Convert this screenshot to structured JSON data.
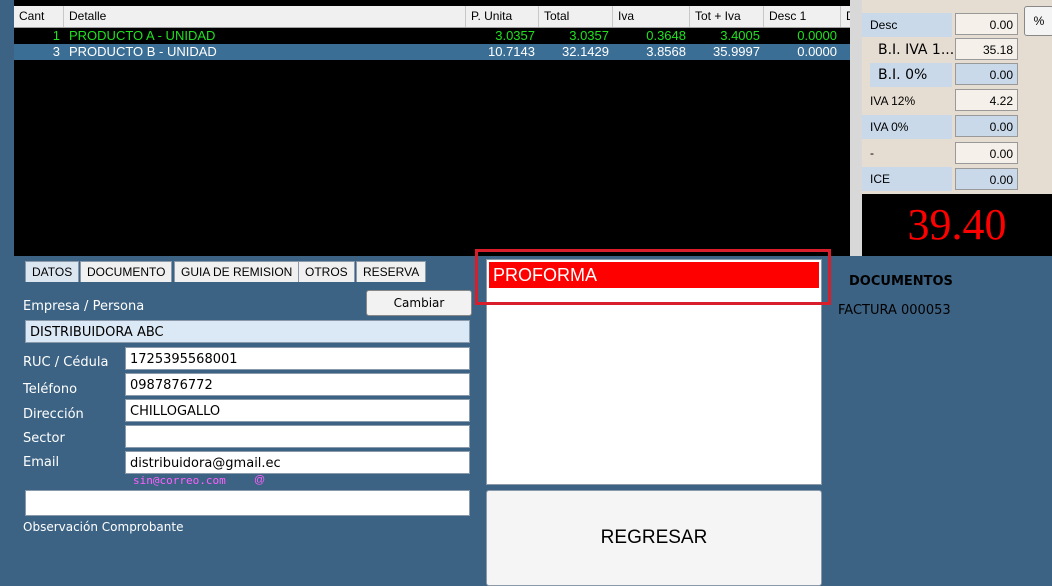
{
  "table": {
    "headers": [
      "Cant",
      "Detalle",
      "P. Unita",
      "Total",
      "Iva",
      "Tot + Iva",
      "Desc 1",
      "D"
    ],
    "rows": [
      [
        "1",
        "PRODUCTO A  - UNIDAD",
        "3.0357",
        "3.0357",
        "0.3648",
        "3.4005",
        "0.0000"
      ],
      [
        "3",
        "PRODUCTO B  - UNIDAD",
        "10.7143",
        "32.1429",
        "3.8568",
        "35.9997",
        "0.0000"
      ]
    ]
  },
  "totals": {
    "desc_label": "Desc",
    "desc_value": "0.00",
    "bi_iva_label": "B.I. IVA 1...",
    "bi_iva_value": "35.18",
    "bi0_label": "B.I. 0%",
    "bi0_value": "0.00",
    "iva12_label": "IVA 12%",
    "iva12_value": "4.22",
    "iva0_label": "IVA 0%",
    "iva0_value": "0.00",
    "dash_label": "-",
    "dash_value": "0.00",
    "ice_label": "ICE",
    "ice_value": "0.00",
    "percent_button": "%",
    "grand_total": "39.40"
  },
  "tabs": [
    "DATOS",
    "DOCUMENTO",
    "GUIA DE REMISION",
    "OTROS",
    "RESERVA"
  ],
  "form": {
    "empresa_label": "Empresa / Persona",
    "cambiar_button": "Cambiar",
    "empresa_value": "DISTRIBUIDORA ABC",
    "ruc_label": "RUC / Cédula",
    "ruc_value": "1725395568001",
    "telefono_label": "Teléfono",
    "telefono_value": "0987876772",
    "direccion_label": "Dirección",
    "direccion_value": "CHILLOGALLO",
    "sector_label": "Sector",
    "sector_value": "",
    "email_label": "Email",
    "email_value": "distribuidora@gmail.ec",
    "email_hint": "sin@correo.com",
    "email_at": "@",
    "observacion_label": "Observación Comprobante",
    "observacion_value": ""
  },
  "doc_type": {
    "selected": "PROFORMA",
    "regresar_button": "REGRESAR"
  },
  "documents": {
    "title": "DOCUMENTOS",
    "item": "FACTURA 000053"
  },
  "colors": {
    "background": "#3c6384",
    "highlight": "#d81e2a",
    "selected_doc": "#ff0000",
    "total": "#ff0000"
  }
}
